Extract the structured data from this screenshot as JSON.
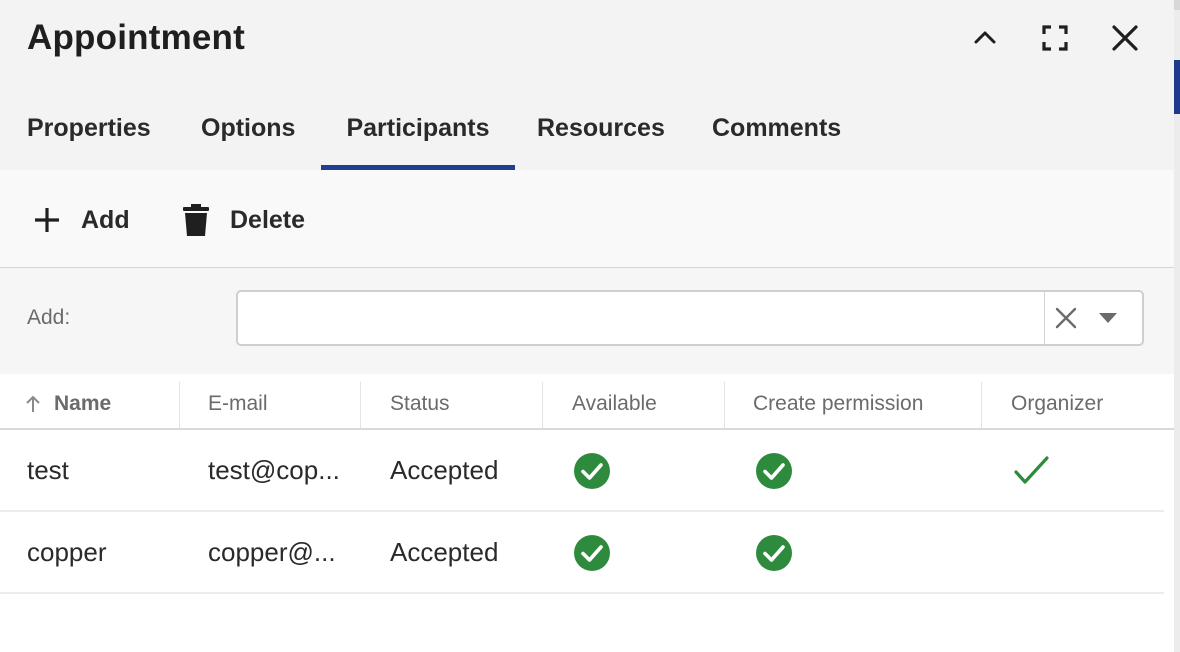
{
  "dialog": {
    "title": "Appointment"
  },
  "window_controls": {
    "collapse": "chevron-up-icon",
    "maximize": "maximize-icon",
    "close": "close-icon"
  },
  "tabs": [
    {
      "label": "Properties",
      "active": false
    },
    {
      "label": "Options",
      "active": false
    },
    {
      "label": "Participants",
      "active": true
    },
    {
      "label": "Resources",
      "active": false
    },
    {
      "label": "Comments",
      "active": false
    }
  ],
  "toolbar": {
    "add_label": "Add",
    "delete_label": "Delete"
  },
  "add_field": {
    "label": "Add:",
    "value": "",
    "placeholder": ""
  },
  "grid": {
    "columns": [
      "Name",
      "E-mail",
      "Status",
      "Available",
      "Create permission",
      "Organizer"
    ],
    "sorted_column": "Name",
    "sort_direction": "ascending",
    "rows": [
      {
        "name": "test",
        "email": "test@cop...",
        "status": "Accepted",
        "available": true,
        "create_permission": true,
        "organizer": true
      },
      {
        "name": "copper",
        "email": "copper@...",
        "status": "Accepted",
        "available": true,
        "create_permission": true,
        "organizer": false
      }
    ]
  },
  "colors": {
    "accent": "#1f3f8f",
    "check_green": "#2e8b3e",
    "header_bg": "#f3f3f3"
  }
}
